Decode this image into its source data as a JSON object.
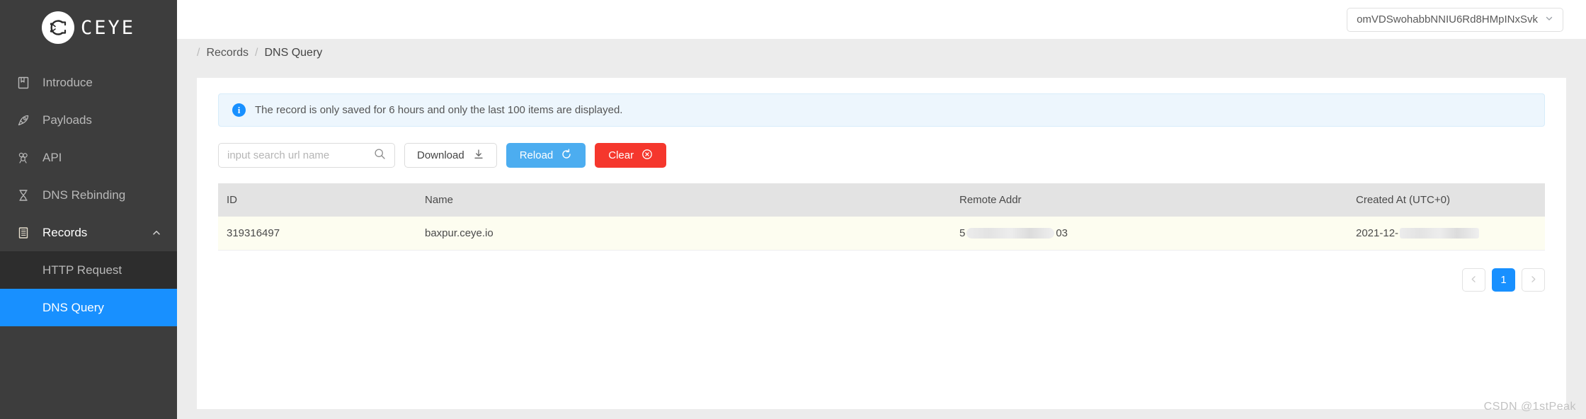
{
  "brand": {
    "name": "CEYE",
    "logo_icon": "ceye-circuit-logo"
  },
  "sidebar": {
    "items": [
      {
        "label": "Introduce",
        "icon": "book-icon"
      },
      {
        "label": "Payloads",
        "icon": "rocket-icon"
      },
      {
        "label": "API",
        "icon": "api-cluster-icon"
      },
      {
        "label": "DNS Rebinding",
        "icon": "hourglass-icon"
      },
      {
        "label": "Records",
        "icon": "records-list-icon",
        "chevron": "chevron-up-icon"
      }
    ],
    "submenu": [
      {
        "label": "HTTP Request",
        "active": false
      },
      {
        "label": "DNS Query",
        "active": true
      }
    ]
  },
  "topbar": {
    "account": "omVDSwohabbNNIU6Rd8HMpINxSvk",
    "caret_icon": "chevron-down-icon"
  },
  "breadcrumb": {
    "leading_sep": "/",
    "sep": "/",
    "parent": "Records",
    "current": "DNS Query"
  },
  "alert": {
    "icon": "info-circle-icon",
    "glyph": "i",
    "text": "The record is only saved for 6 hours and only the last 100 items are displayed."
  },
  "toolbar": {
    "search_placeholder": "input search url name",
    "search_value": "",
    "search_icon": "search-icon",
    "download_label": "Download",
    "download_icon": "download-icon",
    "reload_label": "Reload",
    "reload_icon": "refresh-icon",
    "clear_label": "Clear",
    "clear_icon": "close-circle-icon"
  },
  "table": {
    "columns": [
      "ID",
      "Name",
      "Remote Addr",
      "Created At (UTC+0)"
    ],
    "rows": [
      {
        "id": "319316497",
        "name": "baxpur.ceye.io",
        "remote_addr_prefix": "5",
        "remote_addr_suffix": "03",
        "created_at_prefix": "2021-12-",
        "created_at_suffix": ""
      }
    ]
  },
  "pagination": {
    "prev_icon": "chevron-left-icon",
    "next_icon": "chevron-right-icon",
    "pages": [
      "1"
    ],
    "current": "1"
  },
  "watermark": "CSDN @1stPeak",
  "colors": {
    "sidebar_bg": "#3d3d3d",
    "submenu_bg": "#2d2d2d",
    "accent": "#1890ff",
    "reload_blue": "#4cadf0",
    "clear_red": "#f5372d",
    "row_bg": "#fdfdf0",
    "header_bg": "#e3e3e3",
    "page_bg": "#ececec"
  }
}
